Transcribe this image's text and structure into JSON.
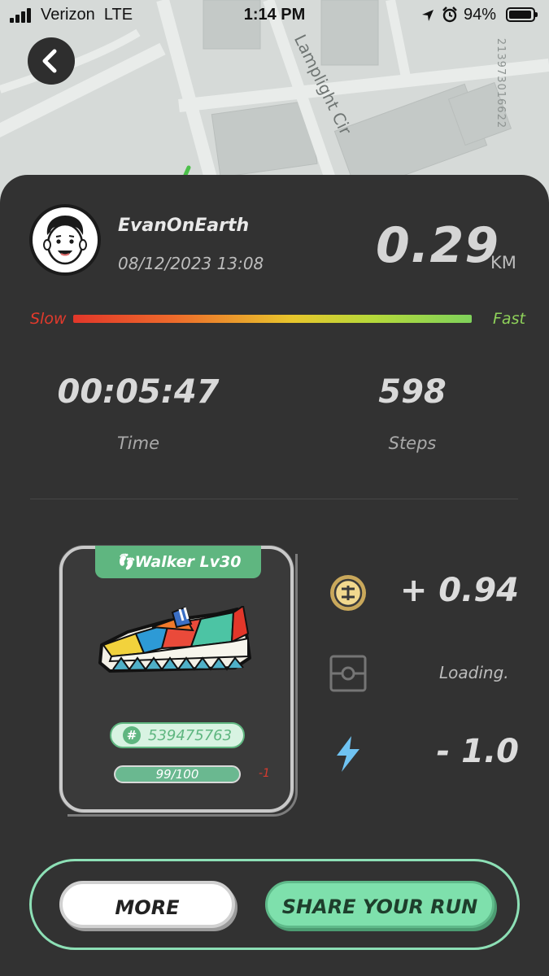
{
  "status_bar": {
    "carrier": "Verizon",
    "network": "LTE",
    "time": "1:14 PM",
    "battery": "94%",
    "icons": [
      "signal-icon",
      "location-arrow-icon",
      "alarm-icon",
      "battery-icon"
    ]
  },
  "map": {
    "street_label": "Lamplight Cir",
    "map_id": "213973016622"
  },
  "header": {
    "back_icon": "chevron-left-icon"
  },
  "profile": {
    "username": "EvanOnEarth",
    "datetime": "08/12/2023 13:08",
    "avatar_icon": "cartoon-face-avatar"
  },
  "run": {
    "distance": "0.29",
    "distance_unit": "KM",
    "speed_slow_label": "Slow",
    "speed_fast_label": "Fast",
    "time_value": "00:05:47",
    "time_label": "Time",
    "steps_value": "598",
    "steps_label": "Steps"
  },
  "sneaker": {
    "level_label": "Walker Lv30",
    "id_number": "539475763",
    "durability": "99/100",
    "durability_fraction": 0.99,
    "durability_change": "-1"
  },
  "rewards": {
    "token_value": "+ 0.94",
    "mystery_status": "Loading.",
    "energy_value": "- 1.0",
    "colors": {
      "token": "#c9a85b",
      "energy": "#6fc3f2",
      "accent": "#5fb680"
    }
  },
  "actions": {
    "more_label": "MORE",
    "share_label": "SHARE YOUR RUN"
  }
}
